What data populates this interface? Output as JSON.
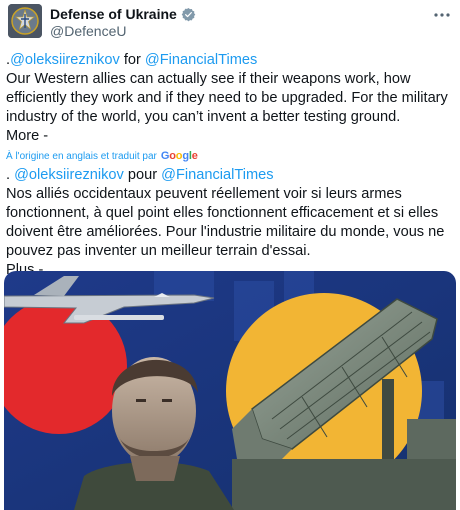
{
  "author": {
    "display_name": "Defense of Ukraine",
    "handle": "@DefenceU"
  },
  "icons": {
    "verified": "verified-badge-icon",
    "more": "more-options-icon",
    "avatar": "ministry-emblem-avatar",
    "google": "google-logo"
  },
  "colors": {
    "link": "#1d9bf0",
    "verified": "#829aab",
    "text": "#0f1419",
    "secondary": "#536471"
  },
  "original": {
    "prefix": ".",
    "mention1": "@oleksiireznikov",
    "joiner": " for ",
    "mention2": "@FinancialTimes",
    "line1": "Our Western allies can actually see if their weapons work, how",
    "line2": "efficiently they work and if they need to be upgraded. For the military",
    "line3": "industry of the world, you can’t invent a better testing ground.",
    "more_label": "More -"
  },
  "translation_note": {
    "label": "À l'origine en anglais et traduit par",
    "google": "Google"
  },
  "translated": {
    "prefix": ". ",
    "mention1": "@oleksiireznikov",
    "joiner": " pour ",
    "mention2": "@FinancialTimes",
    "line1": "Nos alliés occidentaux peuvent réellement voir si leurs armes",
    "line2": "fonctionnent, à quel point elles fonctionnent efficacement et si elles",
    "line3": "doivent être améliorées. Pour l'industrie militaire du monde, vous ne",
    "line4": "pouvez pas inventer un meilleur terrain d'essai.",
    "more_label": "Plus -"
  },
  "media": {
    "description_icon": "collage-zelensky-missile-launcher-jet"
  }
}
